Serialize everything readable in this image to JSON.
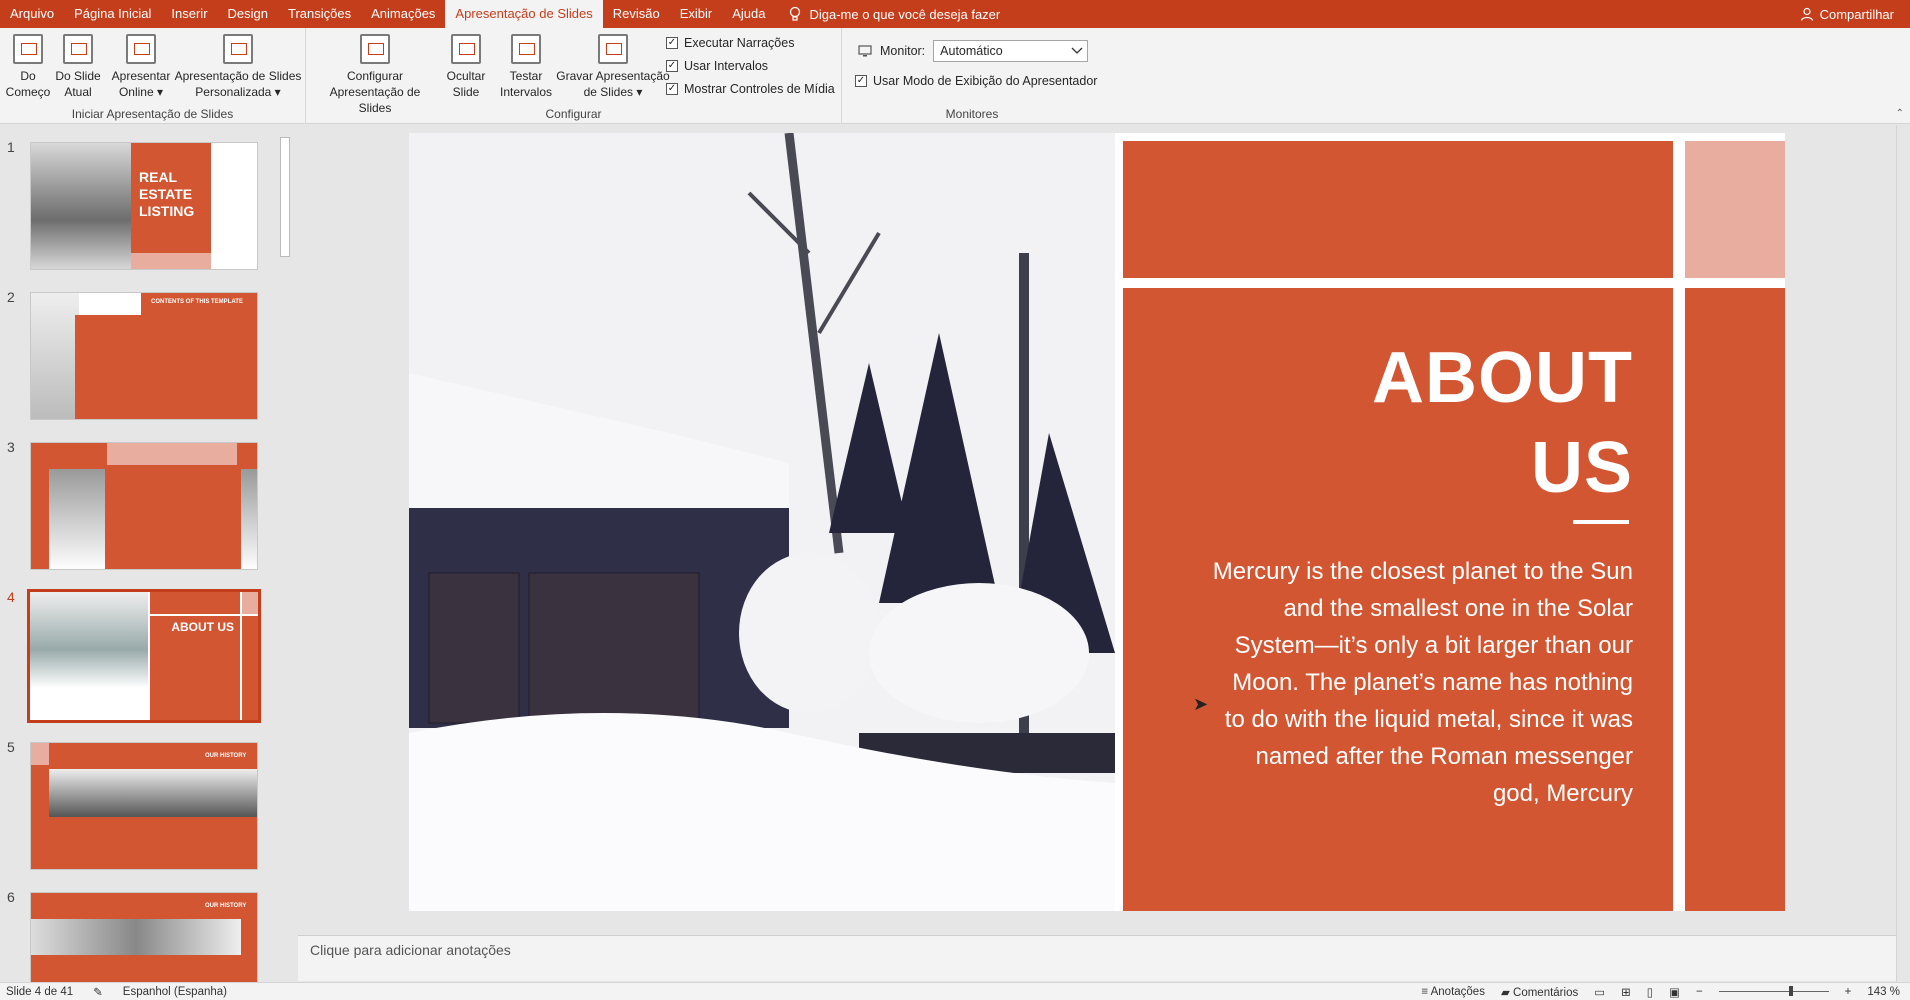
{
  "menu": {
    "tabs": [
      "Arquivo",
      "Página Inicial",
      "Inserir",
      "Design",
      "Transições",
      "Animações",
      "Apresentação de Slides",
      "Revisão",
      "Exibir",
      "Ajuda"
    ],
    "active_tab": "Apresentação de Slides",
    "tell_me": "Diga-me o que você deseja fazer",
    "share": "Compartilhar"
  },
  "ribbon": {
    "group_start": {
      "label": "Iniciar Apresentação de Slides",
      "from_beginning": "Do\nComeço",
      "from_current": "Do Slide\nAtual",
      "present_online": "Apresentar\nOnline ▾",
      "custom_show": "Apresentação de Slides\nPersonalizada ▾"
    },
    "group_setup": {
      "label": "Configurar",
      "setup_show": "Configurar\nApresentação de Slides",
      "hide_slide": "Ocultar\nSlide",
      "rehearse": "Testar\nIntervalos",
      "record": "Gravar Apresentação\nde Slides ▾",
      "chk_narrations": "Executar Narrações",
      "chk_timings": "Usar Intervalos",
      "chk_media": "Mostrar Controles de Mídia"
    },
    "group_monitors": {
      "label": "Monitores",
      "monitor_label": "Monitor:",
      "monitor_value": "Automático",
      "chk_presenter": "Usar Modo de Exibição do Apresentador"
    }
  },
  "thumbnails": [
    {
      "num": "1",
      "title": "REAL ESTATE LISTING"
    },
    {
      "num": "2",
      "title": "CONTENTS OF THIS TEMPLATE"
    },
    {
      "num": "3",
      "title": ""
    },
    {
      "num": "4",
      "title": "ABOUT US"
    },
    {
      "num": "5",
      "title": "OUR HISTORY"
    },
    {
      "num": "6",
      "title": "OUR HISTORY"
    }
  ],
  "slide": {
    "title_line1": "ABOUT",
    "title_line2": "US",
    "body": "Mercury is the closest planet to the Sun and the smallest one in the Solar System—it’s only a bit larger than our Moon. The planet’s name has nothing to do with the liquid metal, since it was named after the Roman messenger god, Mercury"
  },
  "notes_placeholder": "Clique para adicionar anotações",
  "status": {
    "slide_info": "Slide 4 de 41",
    "language": "Espanhol (Espanha)",
    "notes": "Anotações",
    "comments": "Comentários",
    "zoom": "143 %"
  },
  "colors": {
    "accent": "#c43e1c",
    "slide_orange": "#d35632",
    "slide_pink": "#e9ada0"
  }
}
